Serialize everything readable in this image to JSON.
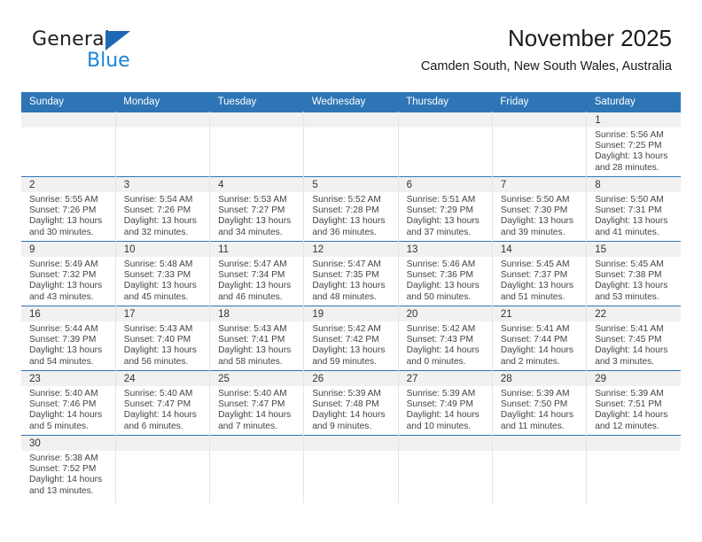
{
  "brand": {
    "name_part1": "General",
    "name_part2": "Blue",
    "logo_icon": "blue-triangle-logo"
  },
  "header": {
    "title": "November 2025",
    "subtitle": "Camden South, New South Wales, Australia"
  },
  "colors": {
    "header_blue": "#2e75b6",
    "daynum_band": "#f1f1f1",
    "brand_blue": "#1d84d6",
    "logo_triangle": "#1d69b4",
    "cell_divider": "#e4e4e4"
  },
  "calendar": {
    "weekday_headers": [
      "Sunday",
      "Monday",
      "Tuesday",
      "Wednesday",
      "Thursday",
      "Friday",
      "Saturday"
    ],
    "weeks": [
      [
        {
          "day": "",
          "lines": []
        },
        {
          "day": "",
          "lines": []
        },
        {
          "day": "",
          "lines": []
        },
        {
          "day": "",
          "lines": []
        },
        {
          "day": "",
          "lines": []
        },
        {
          "day": "",
          "lines": []
        },
        {
          "day": "1",
          "lines": [
            "Sunrise: 5:56 AM",
            "Sunset: 7:25 PM",
            "Daylight: 13 hours",
            "and 28 minutes."
          ]
        }
      ],
      [
        {
          "day": "2",
          "lines": [
            "Sunrise: 5:55 AM",
            "Sunset: 7:26 PM",
            "Daylight: 13 hours",
            "and 30 minutes."
          ]
        },
        {
          "day": "3",
          "lines": [
            "Sunrise: 5:54 AM",
            "Sunset: 7:26 PM",
            "Daylight: 13 hours",
            "and 32 minutes."
          ]
        },
        {
          "day": "4",
          "lines": [
            "Sunrise: 5:53 AM",
            "Sunset: 7:27 PM",
            "Daylight: 13 hours",
            "and 34 minutes."
          ]
        },
        {
          "day": "5",
          "lines": [
            "Sunrise: 5:52 AM",
            "Sunset: 7:28 PM",
            "Daylight: 13 hours",
            "and 36 minutes."
          ]
        },
        {
          "day": "6",
          "lines": [
            "Sunrise: 5:51 AM",
            "Sunset: 7:29 PM",
            "Daylight: 13 hours",
            "and 37 minutes."
          ]
        },
        {
          "day": "7",
          "lines": [
            "Sunrise: 5:50 AM",
            "Sunset: 7:30 PM",
            "Daylight: 13 hours",
            "and 39 minutes."
          ]
        },
        {
          "day": "8",
          "lines": [
            "Sunrise: 5:50 AM",
            "Sunset: 7:31 PM",
            "Daylight: 13 hours",
            "and 41 minutes."
          ]
        }
      ],
      [
        {
          "day": "9",
          "lines": [
            "Sunrise: 5:49 AM",
            "Sunset: 7:32 PM",
            "Daylight: 13 hours",
            "and 43 minutes."
          ]
        },
        {
          "day": "10",
          "lines": [
            "Sunrise: 5:48 AM",
            "Sunset: 7:33 PM",
            "Daylight: 13 hours",
            "and 45 minutes."
          ]
        },
        {
          "day": "11",
          "lines": [
            "Sunrise: 5:47 AM",
            "Sunset: 7:34 PM",
            "Daylight: 13 hours",
            "and 46 minutes."
          ]
        },
        {
          "day": "12",
          "lines": [
            "Sunrise: 5:47 AM",
            "Sunset: 7:35 PM",
            "Daylight: 13 hours",
            "and 48 minutes."
          ]
        },
        {
          "day": "13",
          "lines": [
            "Sunrise: 5:46 AM",
            "Sunset: 7:36 PM",
            "Daylight: 13 hours",
            "and 50 minutes."
          ]
        },
        {
          "day": "14",
          "lines": [
            "Sunrise: 5:45 AM",
            "Sunset: 7:37 PM",
            "Daylight: 13 hours",
            "and 51 minutes."
          ]
        },
        {
          "day": "15",
          "lines": [
            "Sunrise: 5:45 AM",
            "Sunset: 7:38 PM",
            "Daylight: 13 hours",
            "and 53 minutes."
          ]
        }
      ],
      [
        {
          "day": "16",
          "lines": [
            "Sunrise: 5:44 AM",
            "Sunset: 7:39 PM",
            "Daylight: 13 hours",
            "and 54 minutes."
          ]
        },
        {
          "day": "17",
          "lines": [
            "Sunrise: 5:43 AM",
            "Sunset: 7:40 PM",
            "Daylight: 13 hours",
            "and 56 minutes."
          ]
        },
        {
          "day": "18",
          "lines": [
            "Sunrise: 5:43 AM",
            "Sunset: 7:41 PM",
            "Daylight: 13 hours",
            "and 58 minutes."
          ]
        },
        {
          "day": "19",
          "lines": [
            "Sunrise: 5:42 AM",
            "Sunset: 7:42 PM",
            "Daylight: 13 hours",
            "and 59 minutes."
          ]
        },
        {
          "day": "20",
          "lines": [
            "Sunrise: 5:42 AM",
            "Sunset: 7:43 PM",
            "Daylight: 14 hours",
            "and 0 minutes."
          ]
        },
        {
          "day": "21",
          "lines": [
            "Sunrise: 5:41 AM",
            "Sunset: 7:44 PM",
            "Daylight: 14 hours",
            "and 2 minutes."
          ]
        },
        {
          "day": "22",
          "lines": [
            "Sunrise: 5:41 AM",
            "Sunset: 7:45 PM",
            "Daylight: 14 hours",
            "and 3 minutes."
          ]
        }
      ],
      [
        {
          "day": "23",
          "lines": [
            "Sunrise: 5:40 AM",
            "Sunset: 7:46 PM",
            "Daylight: 14 hours",
            "and 5 minutes."
          ]
        },
        {
          "day": "24",
          "lines": [
            "Sunrise: 5:40 AM",
            "Sunset: 7:47 PM",
            "Daylight: 14 hours",
            "and 6 minutes."
          ]
        },
        {
          "day": "25",
          "lines": [
            "Sunrise: 5:40 AM",
            "Sunset: 7:47 PM",
            "Daylight: 14 hours",
            "and 7 minutes."
          ]
        },
        {
          "day": "26",
          "lines": [
            "Sunrise: 5:39 AM",
            "Sunset: 7:48 PM",
            "Daylight: 14 hours",
            "and 9 minutes."
          ]
        },
        {
          "day": "27",
          "lines": [
            "Sunrise: 5:39 AM",
            "Sunset: 7:49 PM",
            "Daylight: 14 hours",
            "and 10 minutes."
          ]
        },
        {
          "day": "28",
          "lines": [
            "Sunrise: 5:39 AM",
            "Sunset: 7:50 PM",
            "Daylight: 14 hours",
            "and 11 minutes."
          ]
        },
        {
          "day": "29",
          "lines": [
            "Sunrise: 5:39 AM",
            "Sunset: 7:51 PM",
            "Daylight: 14 hours",
            "and 12 minutes."
          ]
        }
      ],
      [
        {
          "day": "30",
          "lines": [
            "Sunrise: 5:38 AM",
            "Sunset: 7:52 PM",
            "Daylight: 14 hours",
            "and 13 minutes."
          ]
        },
        {
          "day": "",
          "lines": []
        },
        {
          "day": "",
          "lines": []
        },
        {
          "day": "",
          "lines": []
        },
        {
          "day": "",
          "lines": []
        },
        {
          "day": "",
          "lines": []
        },
        {
          "day": "",
          "lines": []
        }
      ]
    ]
  }
}
